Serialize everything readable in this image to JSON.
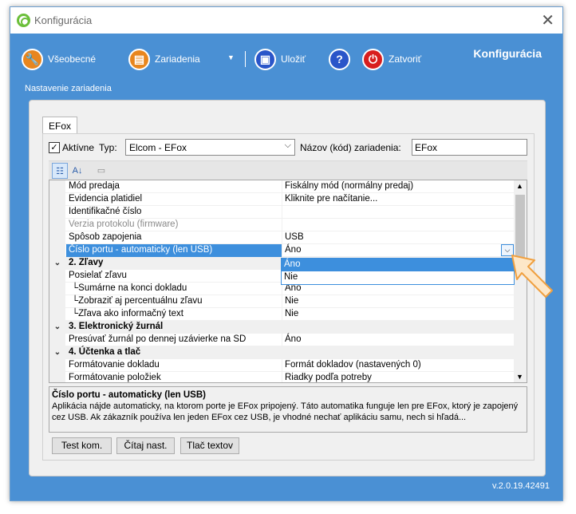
{
  "window": {
    "title": "Konfigurácia",
    "close_glyph": "✕"
  },
  "toolbar": {
    "general_label": "Všeobecné",
    "devices_label": "Zariadenia",
    "dropdown_glyph": "▼",
    "save_label": "Uložiť",
    "help_glyph": "?",
    "close_label": "Zatvoriť",
    "title": "Konfigurácia",
    "subtitle": "Nastavenie zariadenia"
  },
  "tab": {
    "label": "EFox"
  },
  "device": {
    "active_checked": "✓",
    "active_label": "Aktívne",
    "type_label": "Typ:",
    "type_value": "Elcom - EFox",
    "name_label": "Názov (kód) zariadenia:",
    "name_value": "EFox"
  },
  "properties": [
    {
      "name": "Mód predaja",
      "value": "Fiskálny mód (normálny predaj)"
    },
    {
      "name": "Evidencia platidiel",
      "value": "Kliknite pre načítanie..."
    },
    {
      "name": "Identifikačné číslo",
      "value": ""
    },
    {
      "name": "Verzia protokolu (firmware)",
      "value": ""
    },
    {
      "name": "Spôsob zapojenia",
      "value": "USB"
    },
    {
      "name": "Číslo portu - automaticky (len USB)",
      "value": "Áno"
    },
    {
      "name": "2. Zľavy",
      "value": ""
    },
    {
      "name": "Posielať zľavu",
      "value": ""
    },
    {
      "name": "└Sumárne na konci dokladu",
      "value": "Áno"
    },
    {
      "name": "└Zobraziť aj percentuálnu zľavu",
      "value": "Nie"
    },
    {
      "name": "└Zľava ako informačný text",
      "value": "Nie"
    },
    {
      "name": "3. Elektronický žurnál",
      "value": ""
    },
    {
      "name": "Presúvať žurnál po dennej uzávierke na SD",
      "value": "Áno"
    },
    {
      "name": "4. Účtenka a tlač",
      "value": ""
    },
    {
      "name": "Formátovanie dokladu",
      "value": "Formát dokladov (nastavených 0)"
    },
    {
      "name": "Formátovanie položiek",
      "value": "Riadky podľa potreby"
    }
  ],
  "dropdown_options": [
    "Áno",
    "Nie"
  ],
  "glyphs": {
    "collapse": "⌄",
    "up": "▲",
    "down": "▼",
    "dd": "⌵"
  },
  "description": {
    "title": "Číslo portu - automaticky (len USB)",
    "text": "Aplikácia nájde automaticky, na ktorom porte je EFox pripojený. Táto automatika funguje len pre EFox, ktorý je zapojený cez USB. Ak zákazník používa len jeden EFox cez USB, je vhodné nechať aplikáciu samu, nech si hľadá..."
  },
  "buttons": {
    "test": "Test kom.",
    "read": "Čítaj nast.",
    "print": "Tlač textov"
  },
  "version": "v.2.0.19.42491",
  "colors": {
    "accent": "#4a90d4",
    "selection": "#3d8fdd"
  }
}
